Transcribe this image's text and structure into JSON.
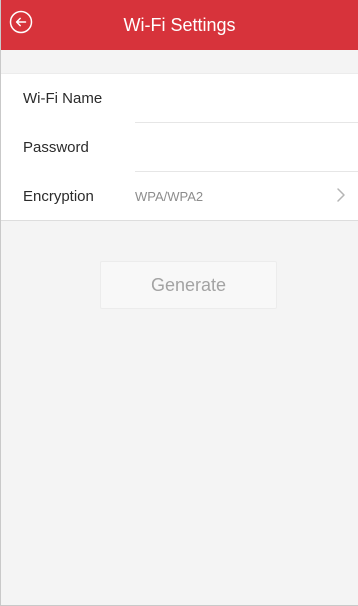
{
  "header": {
    "title": "Wi-Fi Settings",
    "back_icon": "back-circle-icon"
  },
  "form": {
    "wifi_name_label": "Wi-Fi Name",
    "wifi_name_value": "",
    "password_label": "Password",
    "password_value": "",
    "encryption_label": "Encryption",
    "encryption_value": "WPA/WPA2"
  },
  "actions": {
    "generate_label": "Generate"
  },
  "colors": {
    "header_background": "#d7333b",
    "page_background": "#f4f4f4",
    "disabled_text": "#a3a3a3"
  }
}
